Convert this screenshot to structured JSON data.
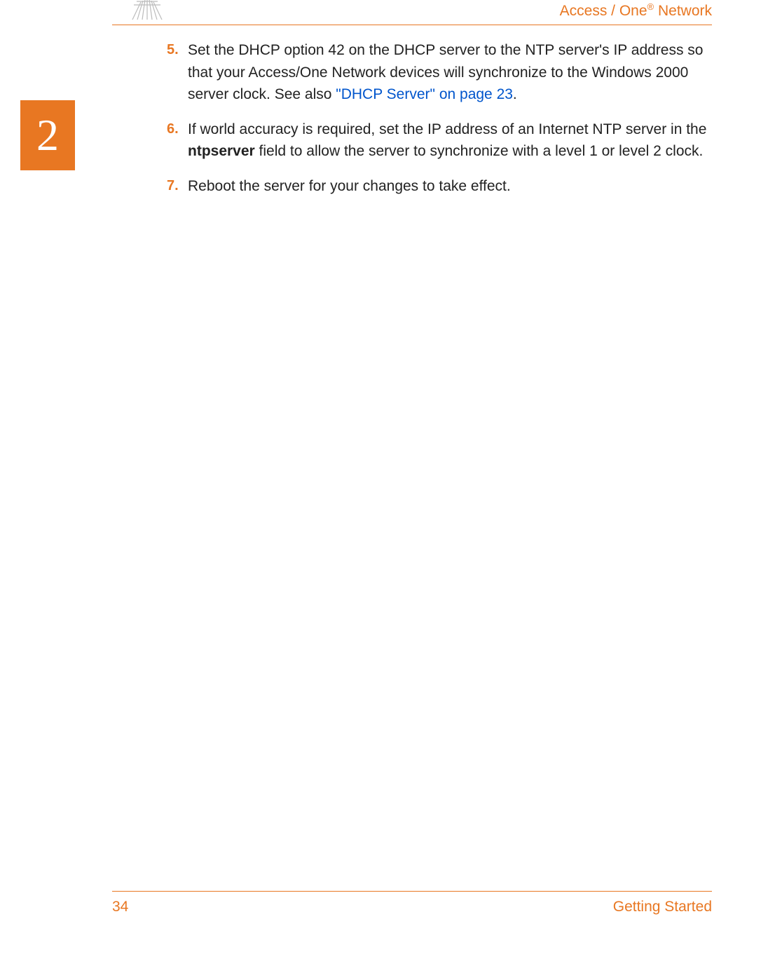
{
  "header": {
    "brand_part1": "Access / One",
    "brand_reg": "®",
    "brand_part2": " Network"
  },
  "chapter": {
    "number": "2"
  },
  "steps": [
    {
      "num": "5.",
      "text_before_link": "Set the DHCP option 42 on the DHCP server to the NTP server's IP address so that your Access/One Network devices will synchronize to the Windows 2000 server clock. See also ",
      "link": "\"DHCP Server\" on page 23",
      "text_after_link": "."
    },
    {
      "num": "6.",
      "text_before_bold": "If world accuracy is required, set the IP address of an Internet NTP server in the ",
      "bold": "ntpserver",
      "text_after_bold": " field to allow the server to synchronize with a level 1 or level 2 clock."
    },
    {
      "num": "7.",
      "text": "Reboot the server for your changes to take effect."
    }
  ],
  "footer": {
    "page": "34",
    "section": "Getting Started"
  }
}
